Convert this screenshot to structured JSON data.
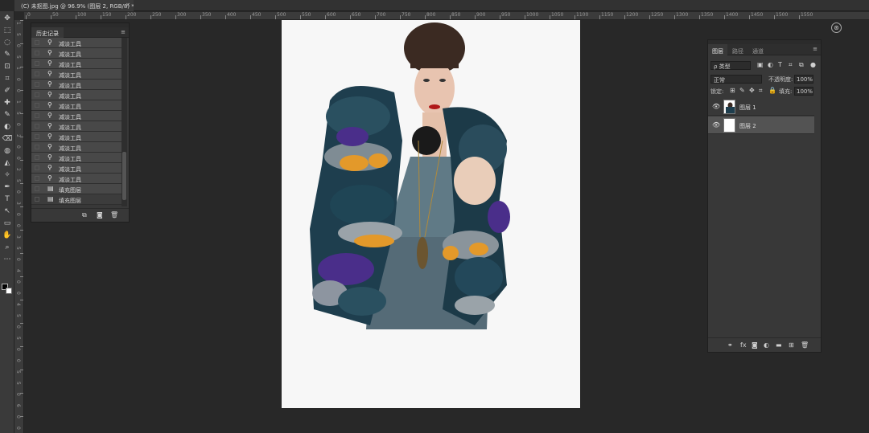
{
  "document_tab": {
    "title": "(C) 未抠图.jpg @ 96.9% (图层 2, RGB/8) *",
    "close": "×"
  },
  "ruler_top_labels": [
    "0",
    "50",
    "100",
    "150",
    "200",
    "250",
    "300",
    "350",
    "400",
    "450",
    "500",
    "550",
    "600",
    "650",
    "700",
    "750",
    "800",
    "850",
    "900",
    "950",
    "1000",
    "1050",
    "1100",
    "1150",
    "1200",
    "1250",
    "1300",
    "1350",
    "1400",
    "1450",
    "1500",
    "1550"
  ],
  "ruler_left_labels": [
    "1",
    "5",
    "0",
    "5",
    "1",
    "0",
    "0",
    "1",
    "5",
    "0",
    "2",
    "0",
    "0",
    "2",
    "5",
    "0",
    "3",
    "0",
    "0",
    "3",
    "5",
    "0",
    "4",
    "0",
    "0",
    "4",
    "5",
    "0",
    "5",
    "0",
    "0",
    "5",
    "5",
    "0",
    "6",
    "0",
    "0"
  ],
  "tools": [
    "✥",
    "⬚",
    "◌",
    "✎",
    "⊡",
    "⌗",
    "✐",
    "✚",
    "✎",
    "◐",
    "⌫",
    "◍",
    "◭",
    "✧",
    "✒",
    "T",
    "↖",
    "▭",
    "✋",
    "⌕",
    "⋯"
  ],
  "history": {
    "tab_label": "历史记录",
    "menu": "≡",
    "items": [
      {
        "icon": "⚲",
        "label": "减淡工具"
      },
      {
        "icon": "⚲",
        "label": "减淡工具"
      },
      {
        "icon": "⚲",
        "label": "减淡工具"
      },
      {
        "icon": "⚲",
        "label": "减淡工具"
      },
      {
        "icon": "⚲",
        "label": "减淡工具"
      },
      {
        "icon": "⚲",
        "label": "减淡工具"
      },
      {
        "icon": "⚲",
        "label": "减淡工具"
      },
      {
        "icon": "⚲",
        "label": "减淡工具"
      },
      {
        "icon": "⚲",
        "label": "减淡工具"
      },
      {
        "icon": "⚲",
        "label": "减淡工具"
      },
      {
        "icon": "⚲",
        "label": "减淡工具"
      },
      {
        "icon": "⚲",
        "label": "减淡工具"
      },
      {
        "icon": "⚲",
        "label": "减淡工具"
      },
      {
        "icon": "⚲",
        "label": "减淡工具"
      },
      {
        "icon": "▤",
        "label": "填充图层"
      },
      {
        "icon": "▤",
        "label": "填充图层"
      }
    ],
    "bottom_icons": [
      "⧉",
      "◙",
      "🗑"
    ]
  },
  "layers": {
    "tabs": [
      "图层",
      "路径",
      "通道"
    ],
    "menu": "≡",
    "kind_filter": "ρ 类型",
    "filter_icons": [
      "▣",
      "◐",
      "T",
      "⌗",
      "⧉",
      "●"
    ],
    "blend_mode": "正常",
    "opacity_label": "不透明度:",
    "opacity_value": "100%",
    "lock_label": "锁定:",
    "lock_icons": [
      "⊞",
      "✎",
      "✥",
      "⌗",
      "🔒"
    ],
    "fill_label": "填充:",
    "fill_value": "100%",
    "items": [
      {
        "eye": "👁",
        "name": "图层 1",
        "selected": false
      },
      {
        "eye": "👁",
        "name": "图层 2",
        "selected": true
      }
    ],
    "bottom_icons": [
      "⚭",
      "fx",
      "◙",
      "◐",
      "▬",
      "⊞",
      "🗑"
    ]
  },
  "panel_collapse": "« ×",
  "right_collapse": "« ×",
  "side_panel_icon": "⊛"
}
